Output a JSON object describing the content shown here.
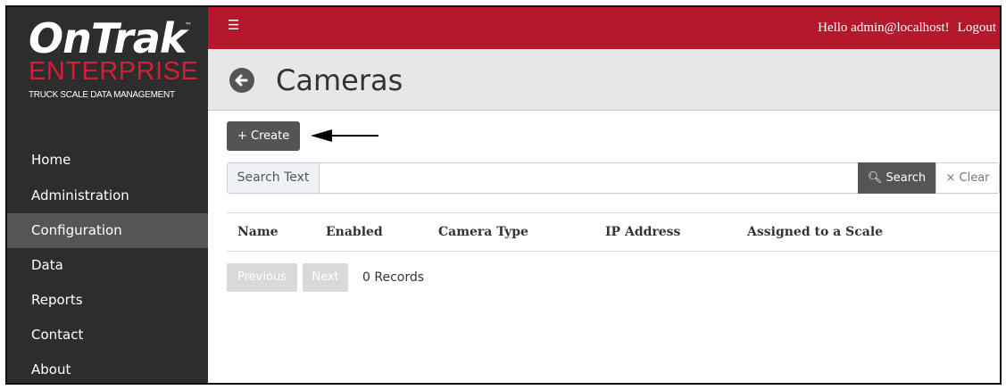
{
  "brand": {
    "logo_main": "OnTrak",
    "logo_tm": "™",
    "logo_sub": "ENTERPRISE",
    "tagline": "TRUCK SCALE DATA MANAGEMENT"
  },
  "sidebar": {
    "items": [
      {
        "label": "Home",
        "active": false
      },
      {
        "label": "Administration",
        "active": false
      },
      {
        "label": "Configuration",
        "active": true
      },
      {
        "label": "Data",
        "active": false
      },
      {
        "label": "Reports",
        "active": false
      },
      {
        "label": "Contact",
        "active": false
      },
      {
        "label": "About",
        "active": false
      }
    ]
  },
  "topbar": {
    "menu_icon": "hamburger-icon",
    "greeting": "Hello admin@localhost!",
    "logout_label": "Logout",
    "color": "#b5182c"
  },
  "page": {
    "title": "Cameras",
    "back_icon": "back-arrow-icon"
  },
  "toolbar": {
    "create_label": "+ Create"
  },
  "search": {
    "label": "Search Text",
    "value": "",
    "search_label": "Search",
    "search_icon": "magnifier-icon",
    "clear_label": "Clear",
    "clear_icon": "times-icon"
  },
  "table": {
    "columns": [
      "Name",
      "Enabled",
      "Camera Type",
      "IP Address",
      "Assigned to a Scale"
    ],
    "rows": []
  },
  "pager": {
    "previous_label": "Previous",
    "next_label": "Next",
    "records_text": "0 Records"
  }
}
